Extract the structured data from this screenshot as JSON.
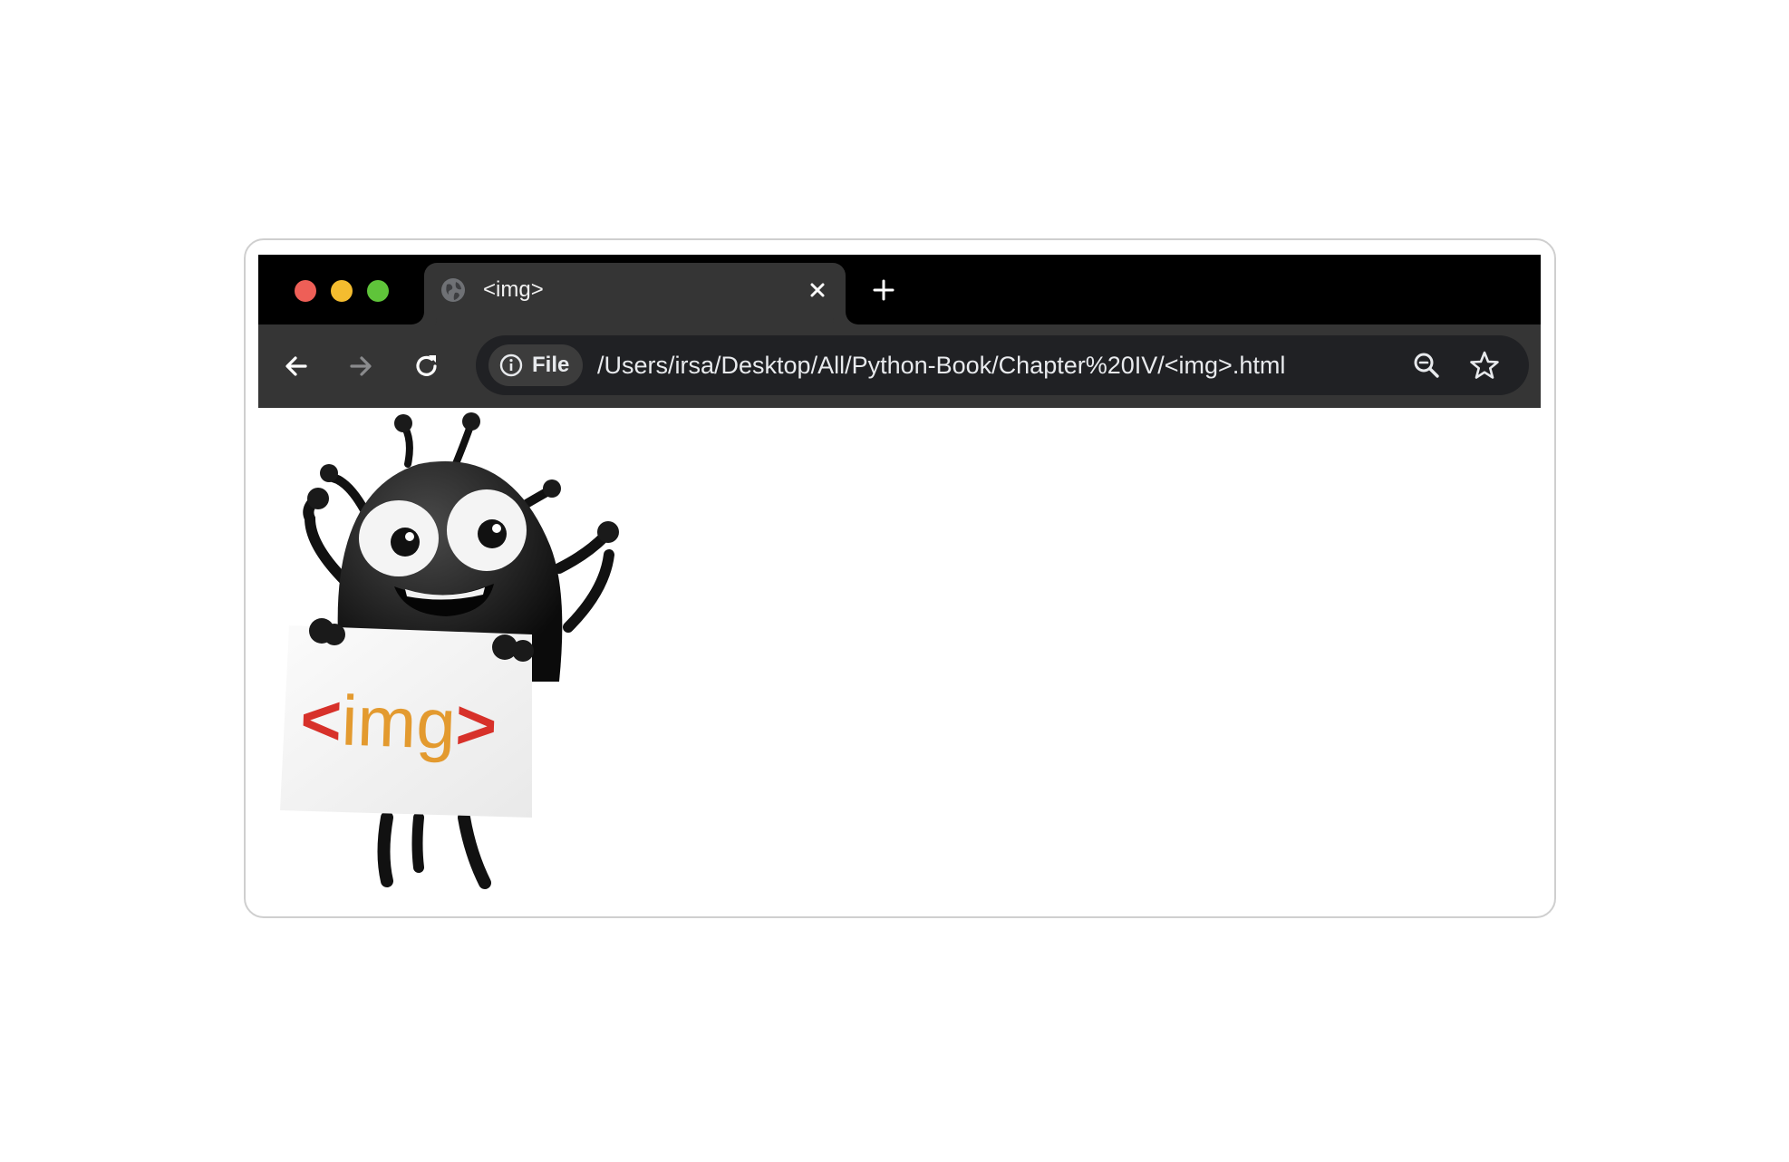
{
  "window": {
    "controls": [
      "close",
      "minimize",
      "maximize"
    ]
  },
  "tab": {
    "title": "<img>",
    "favicon_icon": "globe-icon",
    "close_icon": "close-icon"
  },
  "new_tab_icon": "plus-icon",
  "toolbar": {
    "back_icon": "arrow-left-icon",
    "forward_icon": "arrow-right-icon",
    "reload_icon": "reload-icon"
  },
  "address_bar": {
    "scheme_chip_label": "File",
    "scheme_chip_icon": "info-icon",
    "url": "/Users/irsa/Desktop/All/Python-Book/Chapter%20IV/<img>.html",
    "zoom_icon": "zoom-out-icon",
    "bookmark_icon": "star-icon"
  },
  "page": {
    "image": {
      "sign_text_open": "<",
      "sign_text_tag": "img",
      "sign_text_close": ">",
      "bracket_color": "#d7312a",
      "tag_color": "#e39a2f"
    }
  },
  "colors": {
    "titlebar": "#000000",
    "toolbar": "#353535",
    "omnibox": "#202124",
    "traffic_close": "#ee5f57",
    "traffic_min": "#f4bc2f",
    "traffic_max": "#5fc43a"
  }
}
